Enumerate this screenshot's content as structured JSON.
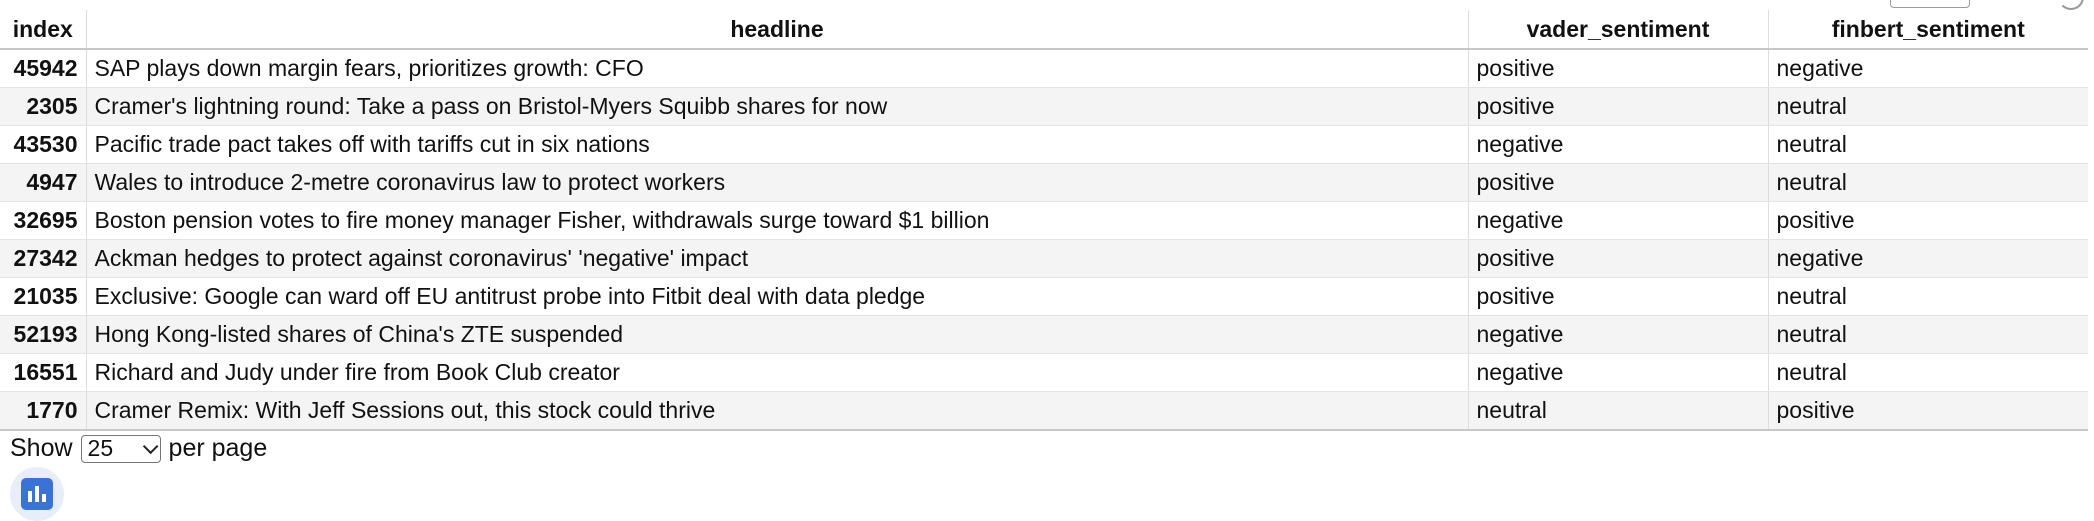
{
  "table": {
    "columns": [
      "index",
      "headline",
      "vader_sentiment",
      "finbert_sentiment"
    ],
    "rows": [
      {
        "index": "45942",
        "headline": "SAP plays down margin fears, prioritizes growth: CFO",
        "vader": "positive",
        "finbert": "negative"
      },
      {
        "index": "2305",
        "headline": "Cramer's lightning round: Take a pass on Bristol-Myers Squibb shares for now",
        "vader": "positive",
        "finbert": "neutral"
      },
      {
        "index": "43530",
        "headline": "Pacific trade pact takes off with tariffs cut in six nations",
        "vader": "negative",
        "finbert": "neutral"
      },
      {
        "index": "4947",
        "headline": "Wales to introduce 2-metre coronavirus law to protect workers",
        "vader": "positive",
        "finbert": "neutral"
      },
      {
        "index": "32695",
        "headline": "Boston pension votes to fire money manager Fisher, withdrawals surge toward $1 billion",
        "vader": "negative",
        "finbert": "positive"
      },
      {
        "index": "27342",
        "headline": "Ackman hedges to protect against coronavirus' 'negative' impact",
        "vader": "positive",
        "finbert": "negative"
      },
      {
        "index": "21035",
        "headline": "Exclusive: Google can ward off EU antitrust probe into Fitbit deal with data pledge",
        "vader": "positive",
        "finbert": "neutral"
      },
      {
        "index": "52193",
        "headline": "Hong Kong-listed shares of China's ZTE suspended",
        "vader": "negative",
        "finbert": "neutral"
      },
      {
        "index": "16551",
        "headline": "Richard and Judy under fire from Book Club creator",
        "vader": "negative",
        "finbert": "neutral"
      },
      {
        "index": "1770",
        "headline": "Cramer Remix: With Jeff Sessions out, this stock could thrive",
        "vader": "neutral",
        "finbert": "positive"
      }
    ]
  },
  "pager": {
    "show_label": "Show",
    "page_size": "25",
    "per_page_label": "per page"
  },
  "chart_button": {
    "icon": "bar-chart-icon",
    "color": "#3a72d6"
  }
}
